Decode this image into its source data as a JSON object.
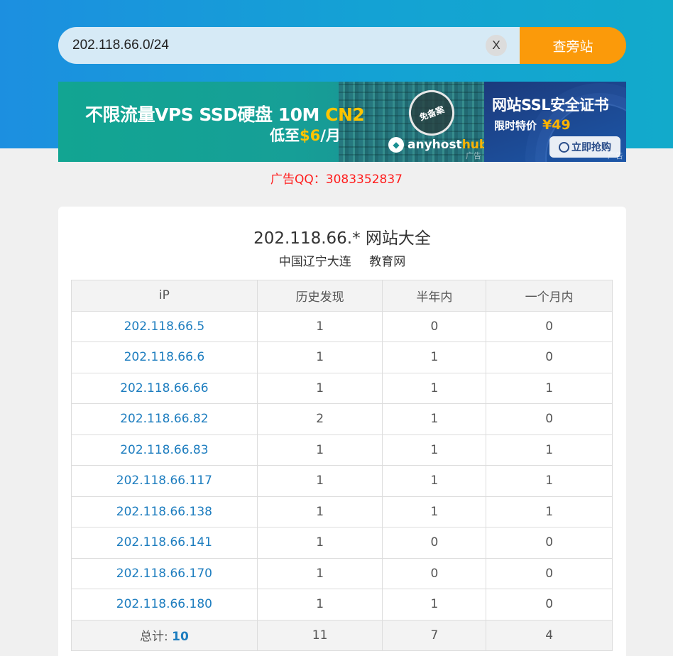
{
  "search": {
    "value": "202.118.66.0/24",
    "clear_label": "X",
    "button_label": "查旁站"
  },
  "ad": {
    "left_title_main": "不限流量VPS SSD硬盘 10M ",
    "left_title_highlight": "CN2",
    "left_sub_prefix": "低至",
    "left_sub_price": "$6",
    "left_sub_suffix": "/月",
    "badge": "免备案",
    "brand_name": "anyhost",
    "brand_highlight": "hub",
    "tag": "广告",
    "right_title": "网站SSL安全证书",
    "right_sub": "限时特价",
    "right_price": "¥49",
    "right_button": "立即抢购",
    "right_tag": "广告"
  },
  "ad_contact": "广告QQ：3083352837",
  "card": {
    "title": "202.118.66.* 网站大全",
    "location": "中国辽宁大连",
    "network": "教育网"
  },
  "table": {
    "headers": [
      "iP",
      "历史发现",
      "半年内",
      "一个月内"
    ],
    "rows": [
      {
        "ip": "202.118.66.5",
        "history": "1",
        "half_year": "0",
        "month": "0"
      },
      {
        "ip": "202.118.66.6",
        "history": "1",
        "half_year": "1",
        "month": "0"
      },
      {
        "ip": "202.118.66.66",
        "history": "1",
        "half_year": "1",
        "month": "1"
      },
      {
        "ip": "202.118.66.82",
        "history": "2",
        "half_year": "1",
        "month": "0"
      },
      {
        "ip": "202.118.66.83",
        "history": "1",
        "half_year": "1",
        "month": "1"
      },
      {
        "ip": "202.118.66.117",
        "history": "1",
        "half_year": "1",
        "month": "1"
      },
      {
        "ip": "202.118.66.138",
        "history": "1",
        "half_year": "1",
        "month": "1"
      },
      {
        "ip": "202.118.66.141",
        "history": "1",
        "half_year": "0",
        "month": "0"
      },
      {
        "ip": "202.118.66.170",
        "history": "1",
        "half_year": "0",
        "month": "0"
      },
      {
        "ip": "202.118.66.180",
        "history": "1",
        "half_year": "1",
        "month": "0"
      }
    ],
    "total": {
      "label": "总计:",
      "count": "10",
      "history": "11",
      "half_year": "7",
      "month": "4"
    }
  },
  "colors": {
    "header_blue": "#1c8fe0",
    "search_orange": "#fb9a0a",
    "link_blue": "#1d7dbf",
    "ad_contact_red": "#ff1d1d"
  }
}
